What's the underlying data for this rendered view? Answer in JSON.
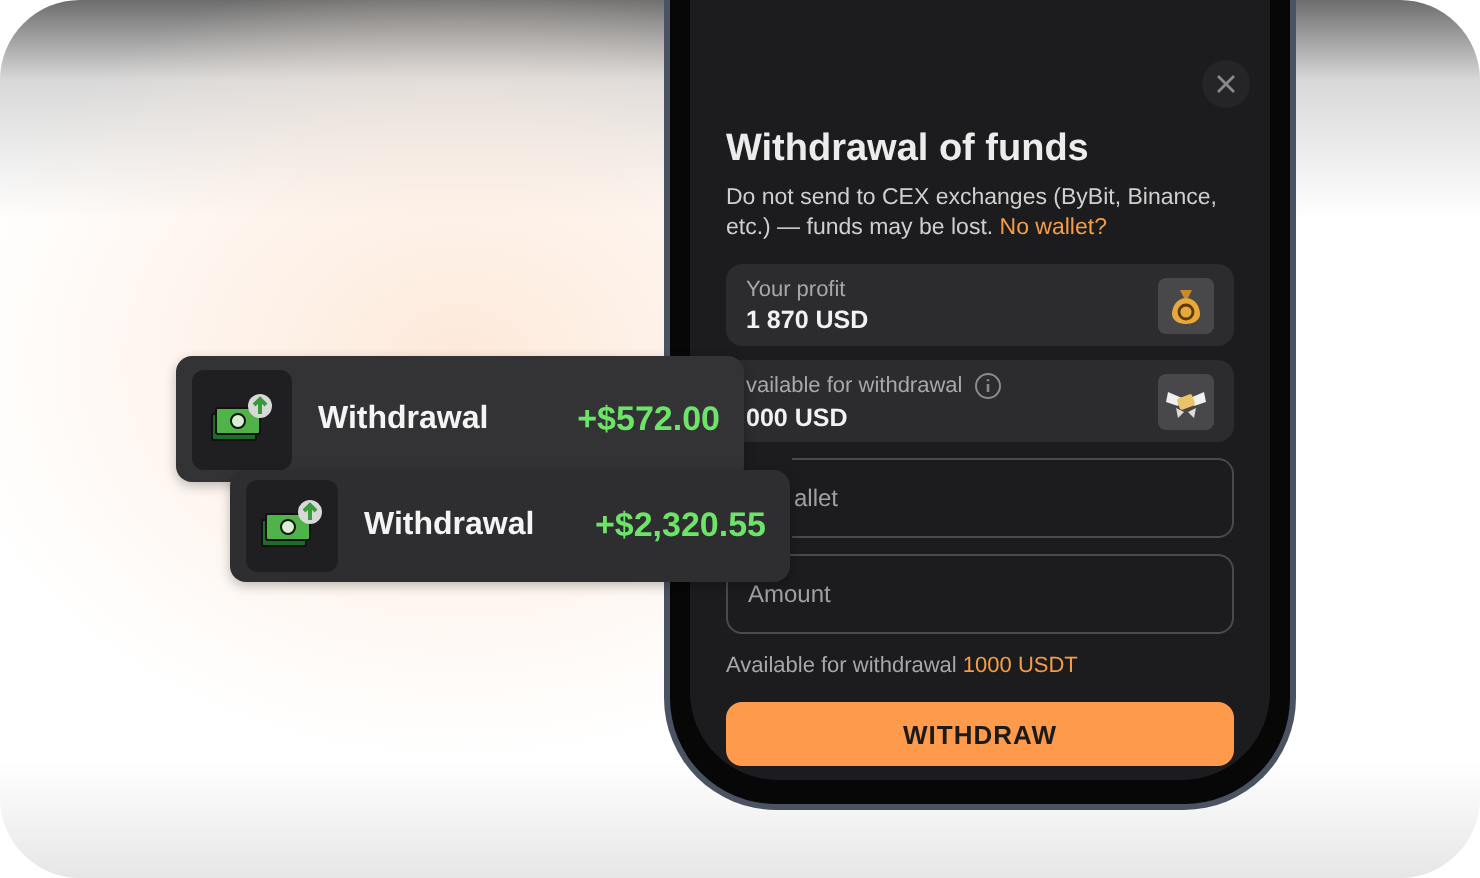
{
  "notifications": [
    {
      "label": "Withdrawal",
      "amount": "+$572.00"
    },
    {
      "label": "Withdrawal",
      "amount": "+$2,320.55"
    }
  ],
  "dialog": {
    "title": "Withdrawal of funds",
    "warning": "Do not send to CEX exchanges (ByBit, Binance, etc.) — funds may be lost.",
    "link": "No wallet?",
    "stats": [
      {
        "kind": "money-bag",
        "label": "Your profit",
        "value": "1 870 USD",
        "info": false
      },
      {
        "kind": "winged-money",
        "label": "vailable for withdrawal",
        "value": "000 USD",
        "info": true
      }
    ],
    "fields": [
      {
        "placeholder": "allet"
      },
      {
        "placeholder": "Amount"
      }
    ],
    "hint": {
      "text": "Available for withdrawal",
      "amount": "1000 USDT"
    },
    "button": "WITHDRAW"
  }
}
